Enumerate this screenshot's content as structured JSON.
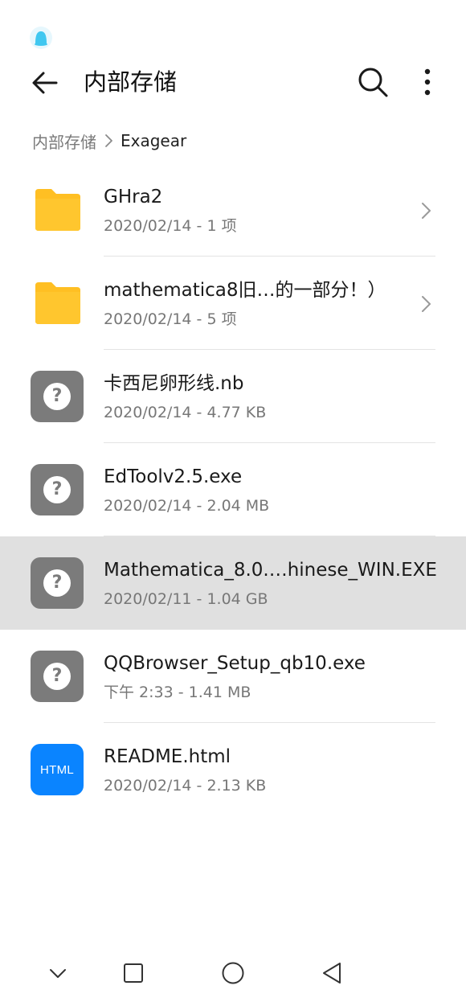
{
  "status_bar": {
    "notification_icon": "qq-penguin-icon"
  },
  "app_bar": {
    "title": "内部存储",
    "back_icon": "arrow-left-icon",
    "search_icon": "search-icon",
    "more_icon": "more-vertical-icon"
  },
  "breadcrumb": {
    "root": "内部存储",
    "current": "Exagear"
  },
  "files": [
    {
      "name": "GHra2",
      "meta": "2020/02/14 - 1 项",
      "type": "folder",
      "icon": "folder-icon",
      "has_chevron": true,
      "selected": false
    },
    {
      "name": "mathematica8旧…的一部分！）",
      "meta": "2020/02/14 - 5 项",
      "type": "folder",
      "icon": "folder-icon",
      "has_chevron": true,
      "selected": false
    },
    {
      "name": "卡西尼卵形线.nb",
      "meta": "2020/02/14 - 4.77 KB",
      "type": "unknown",
      "icon": "unknown-file-icon",
      "has_chevron": false,
      "selected": false
    },
    {
      "name": "EdToolv2.5.exe",
      "meta": "2020/02/14 - 2.04 MB",
      "type": "unknown",
      "icon": "unknown-file-icon",
      "has_chevron": false,
      "selected": false
    },
    {
      "name": "Mathematica_8.0.…hinese_WIN.EXE",
      "meta": "2020/02/11 - 1.04 GB",
      "type": "unknown",
      "icon": "unknown-file-icon",
      "has_chevron": false,
      "selected": true
    },
    {
      "name": "QQBrowser_Setup_qb10.exe",
      "meta": "下午 2:33  - 1.41 MB",
      "type": "unknown",
      "icon": "unknown-file-icon",
      "has_chevron": false,
      "selected": false
    },
    {
      "name": "README.html",
      "meta": "2020/02/14 - 2.13 KB",
      "type": "html",
      "icon": "html-file-icon",
      "icon_label": "HTML",
      "has_chevron": false,
      "selected": false
    }
  ],
  "nav_bar": {
    "items": [
      "chevron-down-icon",
      "recents-square-icon",
      "home-circle-icon",
      "back-triangle-icon"
    ]
  },
  "colors": {
    "folder": "#ffbf23",
    "unknown_icon_bg": "#7b7b7b",
    "html_icon_bg": "#0a84ff",
    "selected_row_bg": "#e0e0e0",
    "notification_accent": "#3fc7f0"
  }
}
